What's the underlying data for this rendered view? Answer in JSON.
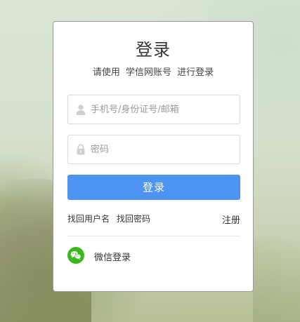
{
  "login": {
    "title": "登录",
    "subtitle": "请使用 学信网账号 进行登录",
    "username_placeholder": "手机号/身份证号/邮箱",
    "username_value": "",
    "password_placeholder": "密码",
    "password_value": "",
    "submit_label": "登录",
    "recover_username": "找回用户名",
    "recover_password": "找回密码",
    "register": "注册",
    "wechat_label": "微信登录"
  },
  "icons": {
    "username": "user-icon",
    "password": "lock-icon",
    "wechat": "wechat-icon"
  },
  "colors": {
    "primary_button": "#4c93f2",
    "wechat_green": "#3cb81a",
    "text": "#333333",
    "placeholder": "#999999"
  }
}
